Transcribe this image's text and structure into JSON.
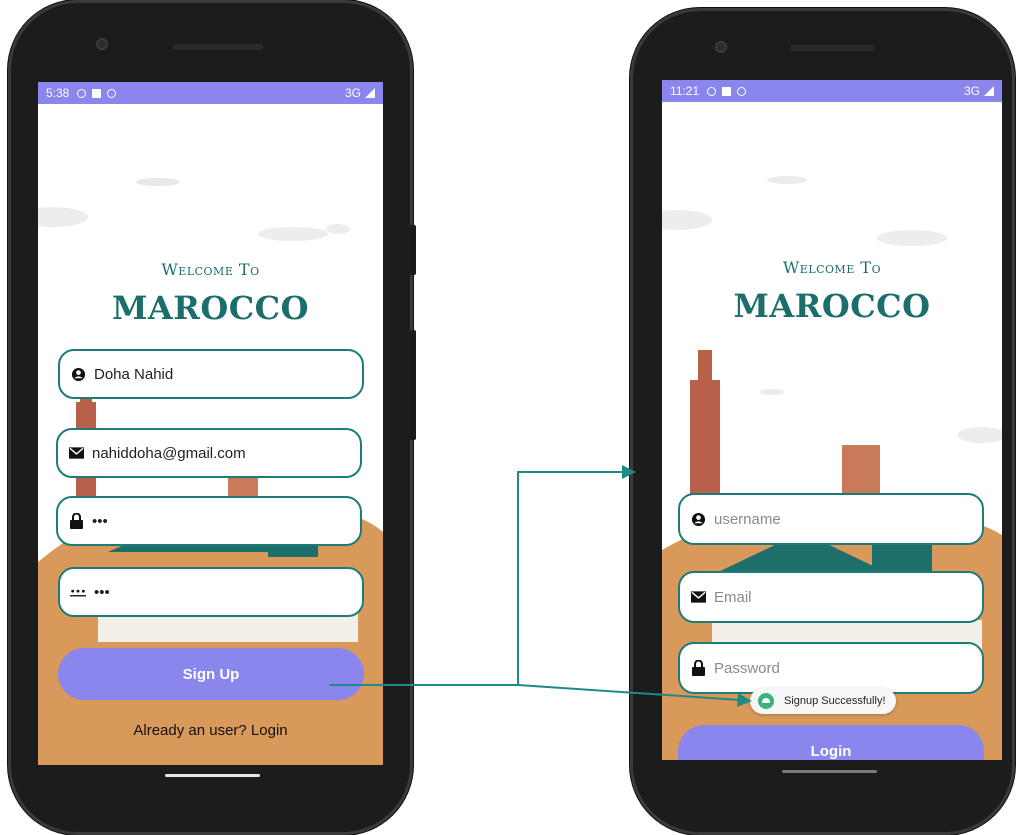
{
  "left_phone": {
    "status": {
      "time": "5:38",
      "network": "3G"
    },
    "welcome": {
      "line1": "Welcome To",
      "line2": "MAROCCO"
    },
    "fields": {
      "username": "Doha Nahid",
      "email": "nahiddoha@gmail.com",
      "password": "•••",
      "confirm_password": "•••"
    },
    "signup_button": "Sign Up",
    "login_link": "Already an user? Login",
    "colors": {
      "accent": "#8a86ee",
      "field_border": "#1e7c78",
      "title": "#1c6e6c",
      "ground": "#d9995b"
    }
  },
  "right_phone": {
    "status": {
      "time": "11:21",
      "network": "3G"
    },
    "welcome": {
      "line1": "Welcome To",
      "line2": "MAROCCO"
    },
    "fields": {
      "username_placeholder": "username",
      "email_placeholder": "Email",
      "password_placeholder": "Password"
    },
    "toast": "Signup Successfully!",
    "login_button": "Login"
  },
  "icons": [
    "account-circle-icon",
    "envelope-icon",
    "lock-icon",
    "password-dots-icon",
    "arrow-connector"
  ]
}
